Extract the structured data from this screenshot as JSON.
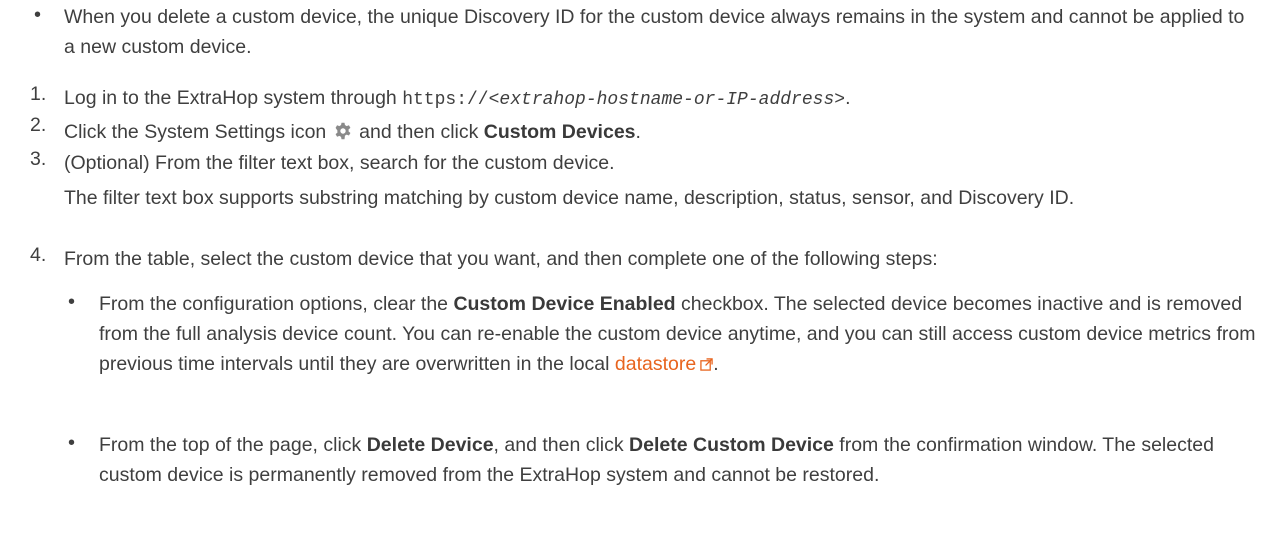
{
  "intro_bullet": {
    "marker": "•",
    "text": "When you delete a custom device, the unique Discovery ID for the custom device always remains in the system and cannot be applied to a new custom device."
  },
  "steps": [
    {
      "num": "1.",
      "text_before": "Log in to the ExtraHop system through ",
      "code_prefix": "https://",
      "code_var": "<extrahop-hostname-or-IP-address>",
      "text_after": "."
    },
    {
      "num": "2.",
      "text_before": "Click the System Settings icon",
      "icon": "gear-icon",
      "text_mid": " and then click ",
      "bold": "Custom Devices",
      "text_after": "."
    },
    {
      "num": "3.",
      "text": "(Optional) From the filter text box, search for the custom device.",
      "note": "The filter text box supports substring matching by custom device name, description, status, sensor, and Discovery ID."
    },
    {
      "num": "4.",
      "text": "From the table, select the custom device that you want, and then complete one of the following steps:",
      "sub": [
        {
          "marker": "•",
          "t1": "From the configuration options, clear the ",
          "b1": "Custom Device Enabled",
          "t2": " checkbox. The selected device becomes inactive and is removed from the full analysis device count. You can re-enable the custom device anytime, and you can still access custom device metrics from previous time intervals until they are overwritten in the local ",
          "link": "datastore",
          "link_icon": "external-link-icon",
          "t3": "."
        },
        {
          "marker": "•",
          "t1": "From the top of the page, click ",
          "b1": "Delete Device",
          "t2": ", and then click ",
          "b2": "Delete Custom Device",
          "t3": " from the confirmation window. The selected custom device is permanently removed from the ExtraHop system and cannot be restored."
        }
      ]
    }
  ],
  "colors": {
    "text": "#3f3f3f",
    "link": "#e8641e",
    "icon": "#8a8a8a"
  }
}
